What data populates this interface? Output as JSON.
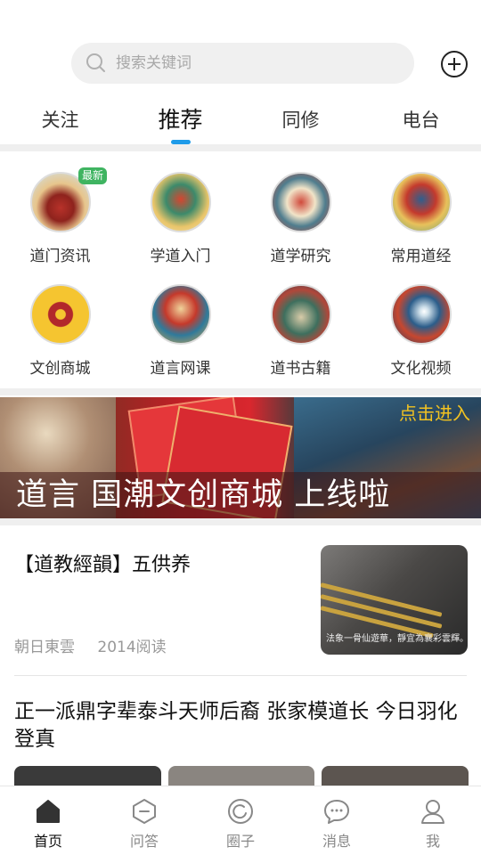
{
  "search": {
    "placeholder": "搜索关键词"
  },
  "tabs": [
    {
      "label": "关注",
      "active": false
    },
    {
      "label": "推荐",
      "active": true
    },
    {
      "label": "同修",
      "active": false
    },
    {
      "label": "电台",
      "active": false
    }
  ],
  "categories": [
    {
      "label": "道门资讯",
      "icon": "temple-gate-icon",
      "badge": "最新"
    },
    {
      "label": "学道入门",
      "icon": "taoist-deity-icon"
    },
    {
      "label": "道学研究",
      "icon": "scholar-study-icon"
    },
    {
      "label": "常用道经",
      "icon": "scripture-deity-icon"
    },
    {
      "label": "文创商城",
      "icon": "coin-shop-icon"
    },
    {
      "label": "道言网课",
      "icon": "lecturer-deity-icon"
    },
    {
      "label": "道书古籍",
      "icon": "ancient-books-icon"
    },
    {
      "label": "文化视频",
      "icon": "crane-video-icon"
    }
  ],
  "banner": {
    "enter_label": "点击进入",
    "caption": "道言 国潮文创商城 上线啦"
  },
  "article1": {
    "title": "【道教經韻】五供养",
    "author": "朝日東雲",
    "reads": "2014阅读",
    "thumb_caption": "法象一骨仙遊華，靜宜為襄彩雲輝。"
  },
  "article2": {
    "title": "正一派鼎字辈泰斗天师后裔 张家模道长 今日羽化登真"
  },
  "bottom_nav": [
    {
      "label": "首页",
      "icon": "home-icon",
      "active": true
    },
    {
      "label": "问答",
      "icon": "qa-icon",
      "active": false
    },
    {
      "label": "圈子",
      "icon": "circle-icon",
      "active": false
    },
    {
      "label": "消息",
      "icon": "message-icon",
      "active": false
    },
    {
      "label": "我",
      "icon": "profile-icon",
      "active": false
    }
  ],
  "colors": {
    "accent": "#1e9be9",
    "badge": "#3fb461",
    "enter": "#f2c221"
  }
}
